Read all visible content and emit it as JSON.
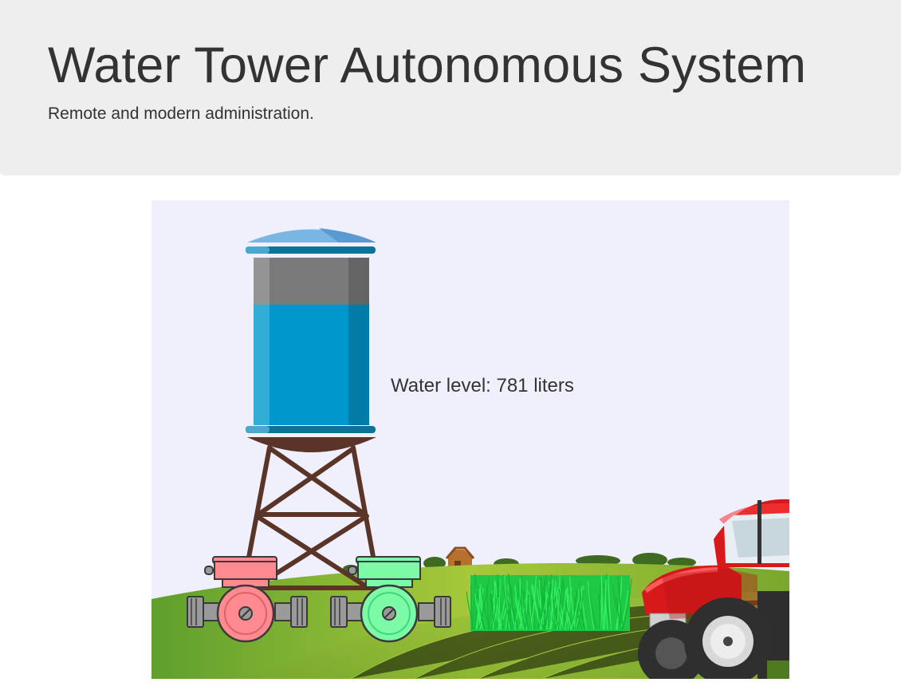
{
  "header": {
    "title": "Water Tower Autonomous System",
    "subtitle": "Remote and modern administration."
  },
  "tank": {
    "level_label": "Water level: 781 liters",
    "fill_fraction": 0.72
  },
  "pumps": [
    {
      "name": "pump-1",
      "state": "off",
      "color": "#ff8a8f"
    },
    {
      "name": "pump-2",
      "state": "on",
      "color": "#7dfaa7"
    }
  ],
  "colors": {
    "background": "#f0effc",
    "water": "#0098cc",
    "tank_empty": "#7a7a7a",
    "tower_frame": "#5b3428",
    "field": "#8bbd3a",
    "crop": "#1fd84a",
    "tractor": "#d7191b"
  }
}
